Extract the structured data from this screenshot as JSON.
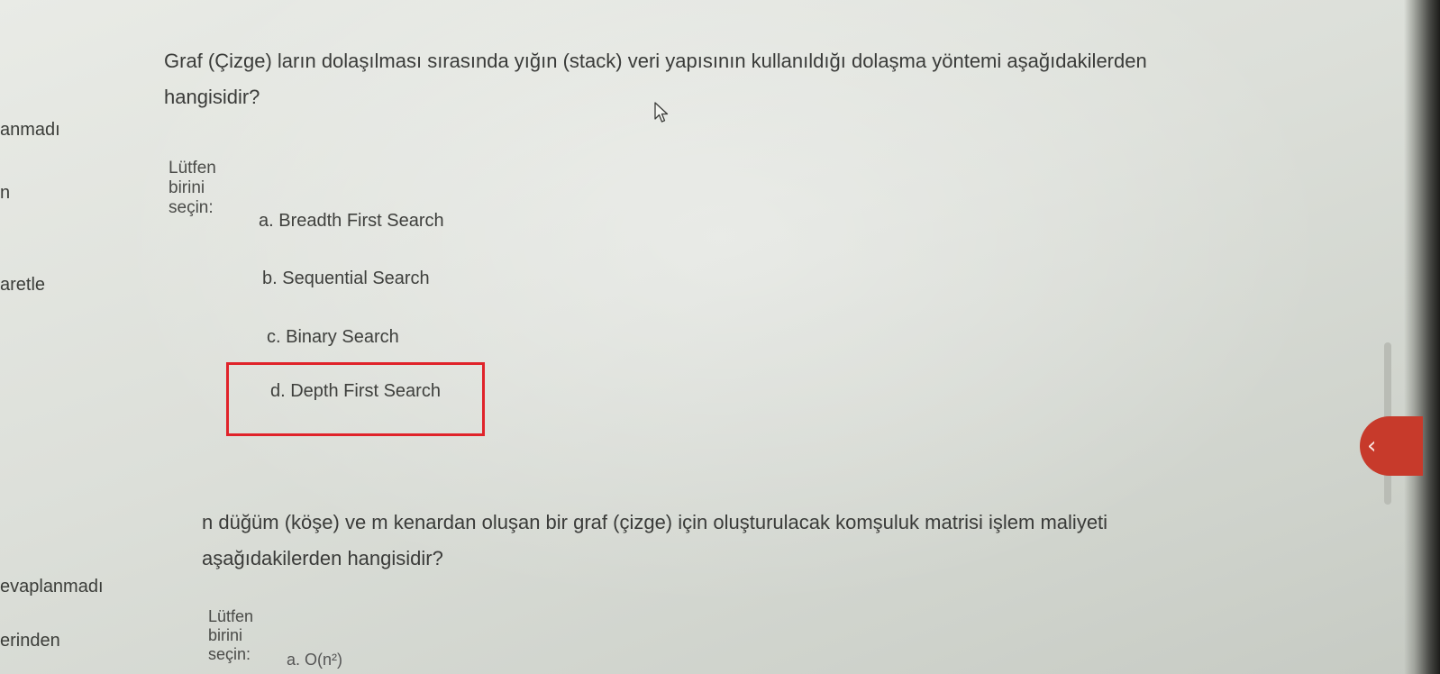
{
  "sidebar": {
    "labels": [
      "anmadı",
      "n",
      "aretle",
      "evaplanmadı",
      "erinden"
    ]
  },
  "question1": {
    "text_line1": "Graf (Çizge) ların dolaşılması sırasında yığın (stack) veri yapısının kullanıldığı dolaşma yöntemi aşağıdakilerden",
    "text_line2": "hangisidir?",
    "prompt": "Lütfen birini seçin:",
    "options": [
      "a. Breadth First Search",
      "b. Sequential Search",
      "c. Binary Search",
      "d. Depth First Search"
    ]
  },
  "question2": {
    "text_line1": "n düğüm (köşe) ve m kenardan oluşan bir graf (çizge) için oluşturulacak komşuluk matrisi işlem maliyeti",
    "text_line2": "aşağıdakilerden hangisidir?",
    "prompt": "Lütfen birini seçin:",
    "first_option_partial": "a. O(n²)"
  },
  "drawer": {
    "icon": "chevron-left-icon"
  },
  "colors": {
    "highlight": "#e0232a",
    "drawer_button": "#c73a2b"
  }
}
